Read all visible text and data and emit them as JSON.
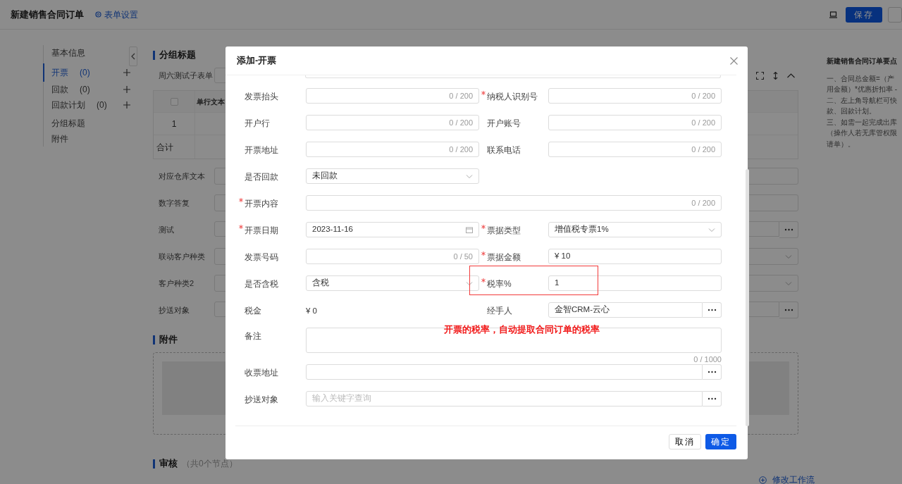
{
  "topbar": {
    "title": "新建销售合同订单",
    "settings_link": "表单设置",
    "save_button": "保存"
  },
  "nav": [
    {
      "label": "基本信息",
      "selected": false,
      "addable": false
    },
    {
      "label": "开票",
      "count": "(0)",
      "selected": true,
      "addable": true
    },
    {
      "label": "回款",
      "count": "(0)",
      "selected": false,
      "addable": true
    },
    {
      "label": "回款计划",
      "count": "(0)",
      "selected": false,
      "addable": true
    },
    {
      "label": "分组标题",
      "selected": false,
      "addable": false
    },
    {
      "label": "附件",
      "selected": false,
      "addable": false
    }
  ],
  "section": {
    "title": "分组标题",
    "subform_label": "周六测试子表单",
    "table": {
      "select_all_checked": false,
      "columns": [
        "单行文本"
      ],
      "rows": [
        {
          "cells": [
            "1"
          ]
        }
      ],
      "total_label": "合计"
    },
    "fields": [
      {
        "label": "对应仓库文本",
        "kind": "text"
      },
      {
        "label": "数字答复",
        "kind": "text"
      },
      {
        "label": "测试",
        "kind": "lookup"
      },
      {
        "label": "联动客户种类",
        "kind": "select"
      },
      {
        "label": "客户种类2",
        "kind": "select"
      },
      {
        "label": "抄送对象",
        "kind": "lookup"
      }
    ]
  },
  "attachments": {
    "title": "附件"
  },
  "review": {
    "title": "审核",
    "note": "（共0个节点）"
  },
  "workflow_link": "修改工作流",
  "tips": {
    "title": "新建销售合同订单要点",
    "lines": [
      "一、合同总金额=（产",
      "用金额）*优惠折扣率 -",
      "二、左上角导航栏可快",
      "款、回款计划。",
      "三、如需一起完成出库",
      "（操作人若无库管权限",
      "请单）。"
    ]
  },
  "modal": {
    "title": "添加-开票",
    "rows": [
      {
        "kind": "pair",
        "fields": [
          {
            "label": "发票抬头",
            "required": false,
            "kind": "text",
            "counter": "0 / 200",
            "highlighted": false
          },
          {
            "label": "纳税人识别号",
            "required": true,
            "kind": "text",
            "counter": "0 / 200",
            "highlighted": false
          }
        ]
      },
      {
        "kind": "pair",
        "fields": [
          {
            "label": "开户行",
            "required": false,
            "kind": "text",
            "counter": "0 / 200",
            "highlighted": false
          },
          {
            "label": "开户账号",
            "required": false,
            "kind": "text",
            "counter": "0 / 200",
            "highlighted": false
          }
        ]
      },
      {
        "kind": "pair",
        "fields": [
          {
            "label": "开票地址",
            "required": false,
            "kind": "text",
            "counter": "0 / 200",
            "highlighted": false
          },
          {
            "label": "联系电话",
            "required": false,
            "kind": "text",
            "counter": "0 / 200",
            "highlighted": false
          }
        ]
      },
      {
        "kind": "pair",
        "fields": [
          {
            "label": "是否回款",
            "required": false,
            "kind": "select",
            "value": "未回款",
            "highlighted": false
          }
        ]
      },
      {
        "kind": "full",
        "fields": [
          {
            "label": "开票内容",
            "required": true,
            "kind": "text",
            "counter": "0 / 200",
            "highlighted": false
          }
        ]
      },
      {
        "kind": "pair",
        "fields": [
          {
            "label": "开票日期",
            "required": true,
            "kind": "date",
            "value": "2023-11-16",
            "highlighted": false
          },
          {
            "label": "票据类型",
            "required": true,
            "kind": "select",
            "value": "增值税专票1%",
            "highlighted": false
          }
        ]
      },
      {
        "kind": "pair",
        "fields": [
          {
            "label": "发票号码",
            "required": false,
            "kind": "text",
            "counter": "0 / 50",
            "highlighted": false
          },
          {
            "label": "票据金额",
            "required": true,
            "kind": "text",
            "value": "¥ 10",
            "highlighted": false
          }
        ]
      },
      {
        "kind": "pair",
        "fields": [
          {
            "label": "是否含税",
            "required": false,
            "kind": "select",
            "value": "含税",
            "highlighted": false
          },
          {
            "label": "税率%",
            "required": true,
            "kind": "text",
            "value": "1",
            "highlighted": true
          }
        ]
      },
      {
        "kind": "pair",
        "fields": [
          {
            "label": "税金",
            "required": false,
            "kind": "static",
            "value": "¥ 0",
            "highlighted": false
          },
          {
            "label": "经手人",
            "required": false,
            "kind": "lookup",
            "value": "金智CRM-云心",
            "highlighted": false
          }
        ]
      },
      {
        "kind": "full",
        "fields": [
          {
            "label": "备注",
            "required": false,
            "kind": "textarea",
            "counter": "0 / 1000",
            "highlighted": false
          }
        ]
      },
      {
        "kind": "full",
        "fields": [
          {
            "label": "收票地址",
            "required": false,
            "kind": "lookup",
            "highlighted": false
          }
        ]
      },
      {
        "kind": "full",
        "fields": [
          {
            "label": "抄送对象",
            "required": false,
            "kind": "lookup",
            "placeholder": "输入关键字查询",
            "highlighted": false
          }
        ]
      }
    ],
    "cancel_button": "取消",
    "confirm_button": "确定"
  },
  "annotation": "开票的税率，自动提取合同订单的税率"
}
